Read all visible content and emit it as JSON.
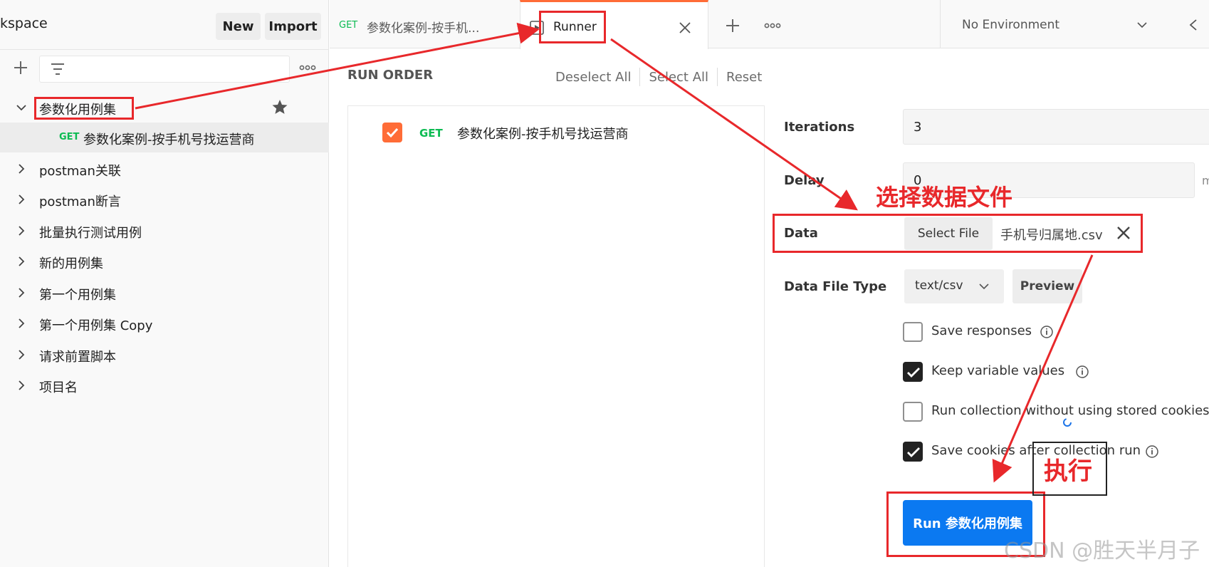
{
  "sidebar": {
    "workspace_title": "kspace",
    "new_label": "New",
    "import_label": "Import",
    "collections": [
      {
        "label": "参数化用例集",
        "expanded": true
      },
      {
        "label": "postman关联"
      },
      {
        "label": "postman断言"
      },
      {
        "label": "批量执行测试用例"
      },
      {
        "label": "新的用例集"
      },
      {
        "label": "第一个用例集"
      },
      {
        "label": "第一个用例集 Copy"
      },
      {
        "label": "请求前置脚本"
      },
      {
        "label": "项目名"
      }
    ],
    "child_request": {
      "method": "GET",
      "label": "参数化案例-按手机号找运营商"
    }
  },
  "tabs": {
    "tab1": {
      "method": "GET",
      "label": "参数化案例-按手机..."
    },
    "tab2": {
      "label": "Runner"
    },
    "environment": "No Environment"
  },
  "run_order": {
    "heading": "RUN ORDER",
    "deselect_all": "Deselect All",
    "select_all": "Select All",
    "reset": "Reset",
    "items": [
      {
        "method": "GET",
        "name": "参数化案例-按手机号找运营商",
        "checked": true
      }
    ]
  },
  "config": {
    "iterations_label": "Iterations",
    "iterations_value": "3",
    "delay_label": "Delay",
    "delay_value": "0",
    "delay_unit": "m",
    "data_label": "Data",
    "select_file_label": "Select File",
    "file_name": "手机号归属地.csv",
    "data_file_type_label": "Data File Type",
    "data_file_type_value": "text/csv",
    "preview_label": "Preview",
    "options": [
      {
        "label": "Save responses",
        "checked": false
      },
      {
        "label": "Keep variable values",
        "checked": true
      },
      {
        "label": "Run collection without using stored cookies",
        "checked": false
      },
      {
        "label": "Save cookies after collection run",
        "checked": true
      }
    ],
    "run_button_label": "Run 参数化用例集"
  },
  "annotations": {
    "select_data_file": "选择数据文件",
    "execute": "执行"
  },
  "watermark": "CSDN @胜天半月子",
  "colors": {
    "accent_orange": "#ff6c37",
    "run_blue": "#0b79f1",
    "get_green": "#0cbb52",
    "annotation_red": "#e8282b"
  }
}
